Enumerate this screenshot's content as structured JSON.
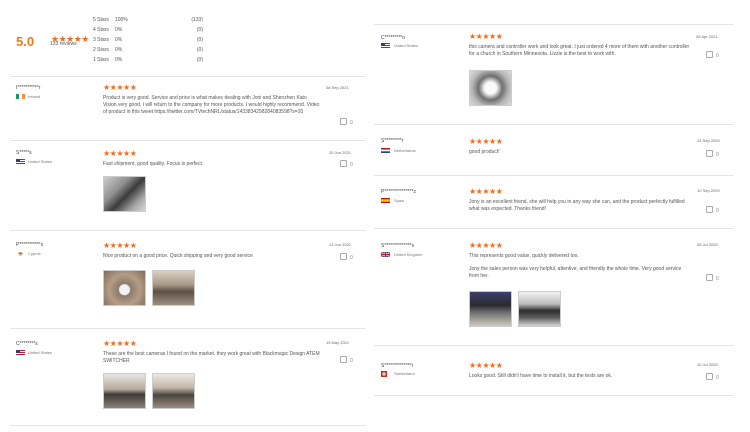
{
  "summary": {
    "score": "5.0",
    "stars": "★★★★★",
    "count": "133 reviews",
    "histogram": [
      {
        "label": "5 Stars",
        "pct": "100%",
        "count": "(133)"
      },
      {
        "label": "4 Stars",
        "pct": "0%",
        "count": "(0)"
      },
      {
        "label": "3 Stars",
        "pct": "0%",
        "count": "(0)"
      },
      {
        "label": "2 Stars",
        "pct": "0%",
        "count": "(0)"
      },
      {
        "label": "1 Stars",
        "pct": "0%",
        "count": "(0)"
      }
    ]
  },
  "reviews": [
    {
      "name": "I***********r",
      "country": "Ireland",
      "stars": "★★★★★",
      "date": "08 Sep 2021",
      "text": "Product is very good. Service and price is what makes dealing with Joni and Shenzhen Kato Vision very good. I will return to the company for more products. I would highly recommend. Video of product in this tweet https://twitter.com/TVtechNRL/status/1433834298284083598?s=20",
      "likes": "0"
    },
    {
      "name": "S*****s",
      "country": "United States",
      "stars": "★★★★★",
      "date": "20 Jun 2021",
      "text": "Fast shipment, good quality. Focus is perfect.",
      "likes": "0"
    },
    {
      "name": "P***********s",
      "country": "Cyprus",
      "stars": "★★★★★",
      "date": "13 Jun 2021",
      "text": "Nice product on a good price. Quick shipping and very good service",
      "likes": "0"
    },
    {
      "name": "C********s",
      "country": "United States",
      "stars": "★★★★★",
      "date": "19 May 2021",
      "text": "These are the best cameras I found on the market.  they work great with Blackmagic Design ATEM SWITCHER",
      "likes": "0"
    },
    {
      "name": "C*********o",
      "country": "United States",
      "stars": "★★★★★",
      "date": "26 Apr 2021",
      "text": "this camera and controller work and look great.  I just ordered 4 more of them with another controller for a church in Southern Minnesota.   Lizzie is the best to work with.",
      "likes": "0"
    },
    {
      "name": "S*********r",
      "country": "Netherlands",
      "stars": "★★★★★",
      "date": "24 Sep 2020",
      "text": "good product!",
      "likes": "0"
    },
    {
      "name": "P***************z",
      "country": "Spain",
      "stars": "★★★★★",
      "date": "10 Sep 2020",
      "text": "Jony is an excellent friend, she will help you in any way she can, and the product perfectly fulfilled what was expected. Thanks friend!",
      "likes": "0"
    },
    {
      "name": "S**************s",
      "country": "United Kingdom",
      "stars": "★★★★★",
      "date": "28 Jul 2020",
      "text": "This represents good value, quickly delivered too.",
      "text2": "Jony the sales person was very helpful, attentive, and friendly the whole time. Very good service from her.",
      "likes": "0"
    },
    {
      "name": "S**************r",
      "country": "Switzerland",
      "stars": "★★★★★",
      "date": "10 Jul 2020",
      "text": "Looks good. Still didn't have time to install it, but the tests are ok.",
      "likes": "0"
    }
  ],
  "colors": {
    "accent": "#f26b1a",
    "score": "#f47a17",
    "divider": "#e6e6e6"
  }
}
